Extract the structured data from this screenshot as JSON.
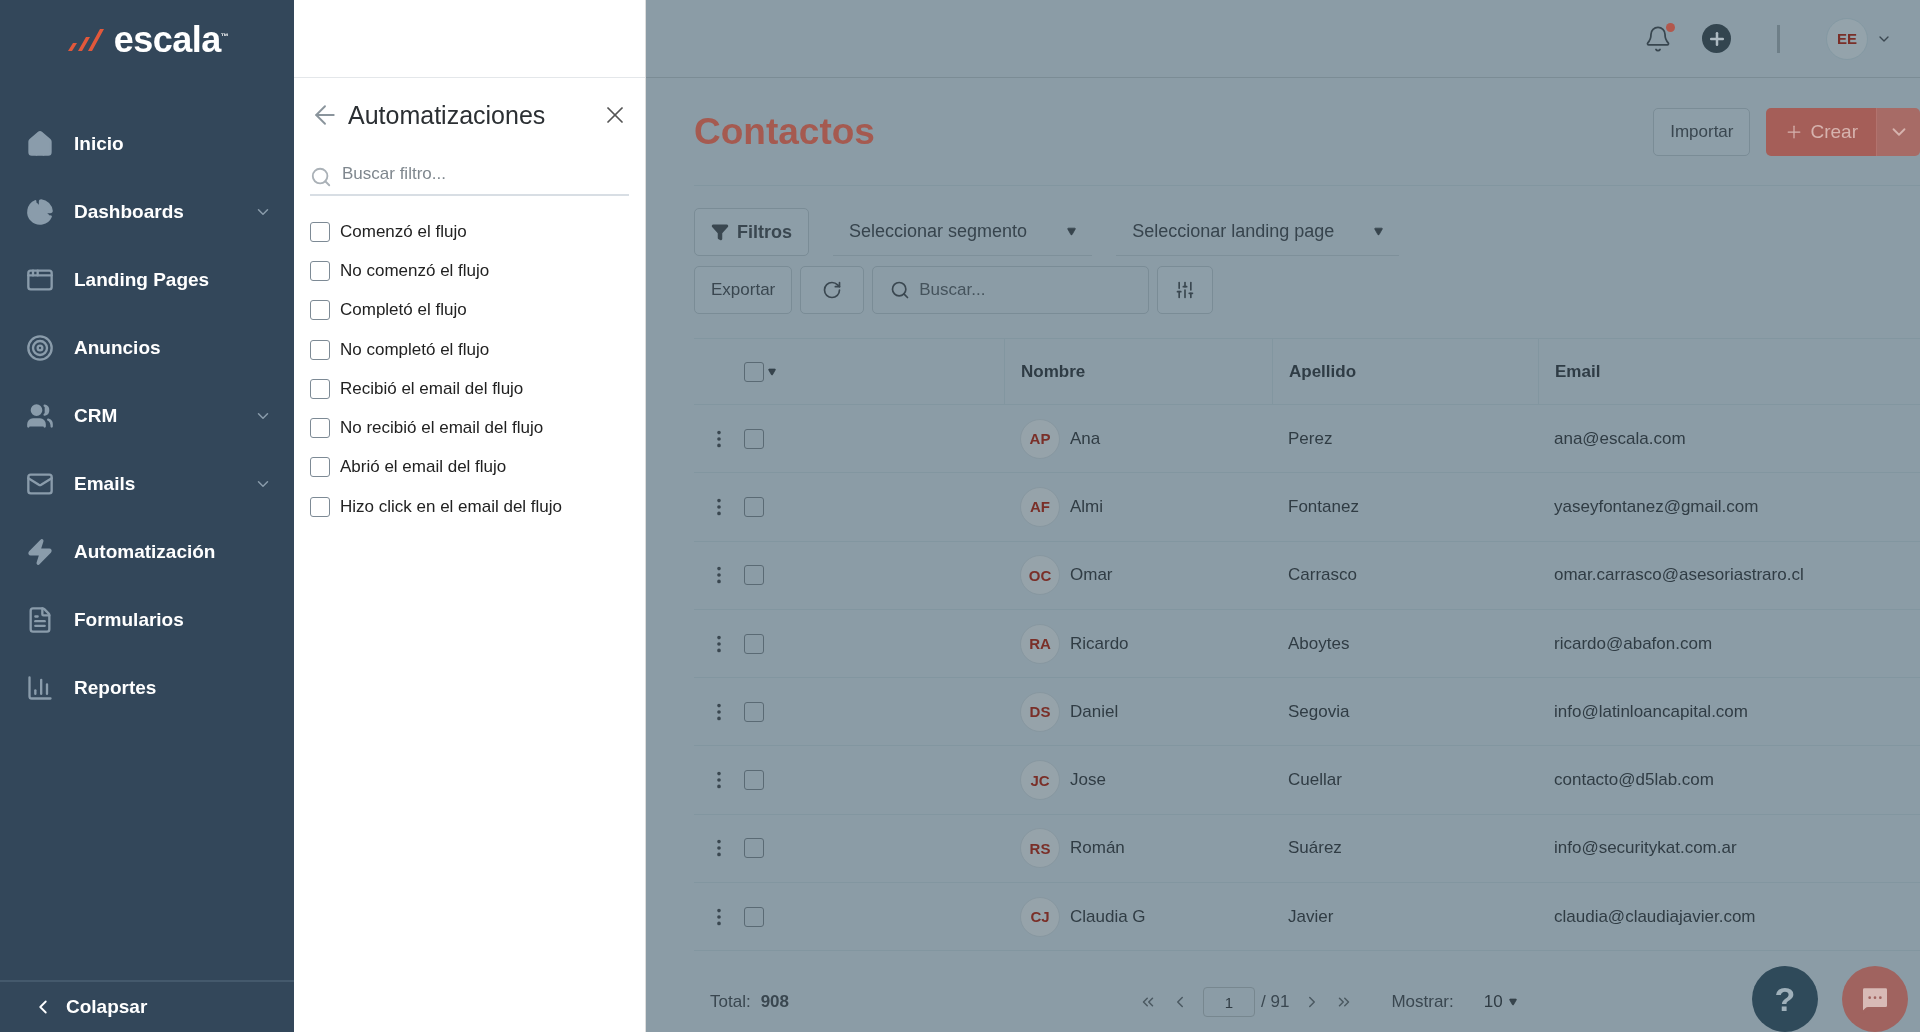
{
  "sidebar": {
    "logo": "escala",
    "trademark": "™",
    "items": [
      {
        "label": "Inicio",
        "has_submenu": false
      },
      {
        "label": "Dashboards",
        "has_submenu": true
      },
      {
        "label": "Landing Pages",
        "has_submenu": false
      },
      {
        "label": "Anuncios",
        "has_submenu": false
      },
      {
        "label": "CRM",
        "has_submenu": true
      },
      {
        "label": "Emails",
        "has_submenu": true
      },
      {
        "label": "Automatización",
        "has_submenu": false
      },
      {
        "label": "Formularios",
        "has_submenu": false
      },
      {
        "label": "Reportes",
        "has_submenu": false
      }
    ],
    "collapse": "Colapsar"
  },
  "drawer": {
    "title": "Automatizaciones",
    "search": {
      "placeholder": "Buscar filtro..."
    },
    "options": [
      {
        "label": "Comenzó el flujo",
        "checked": false
      },
      {
        "label": "No comenzó el flujo",
        "checked": false
      },
      {
        "label": "Completó el flujo",
        "checked": false
      },
      {
        "label": "No completó el flujo",
        "checked": false
      },
      {
        "label": "Recibió el email del flujo",
        "checked": false
      },
      {
        "label": "No recibió el email del flujo",
        "checked": false
      },
      {
        "label": "Abrió el email del flujo",
        "checked": false
      },
      {
        "label": "Hizo click en el email del flujo",
        "checked": false
      }
    ]
  },
  "topbar": {
    "unread_notifications": true,
    "avatar": "EE"
  },
  "page": {
    "title": "Contactos",
    "import": "Importar",
    "create": "Crear"
  },
  "filters": {
    "button": "Filtros",
    "segment": "Seleccionar segmento",
    "landing_page": "Seleccionar landing page"
  },
  "toolbar": {
    "export": "Exportar",
    "search": {
      "placeholder": "Buscar..."
    }
  },
  "table": {
    "all_selected": false,
    "columns": [
      "Nombre",
      "Apellido",
      "Email"
    ],
    "rows": [
      {
        "initials": "AP",
        "first": "Ana",
        "last": "Perez",
        "email": "ana@escala.com",
        "selected": false
      },
      {
        "initials": "AF",
        "first": "Almi",
        "last": "Fontanez",
        "email": "yaseyfontanez@gmail.com",
        "selected": false
      },
      {
        "initials": "OC",
        "first": "Omar",
        "last": "Carrasco",
        "email": "omar.carrasco@asesoriastraro.cl",
        "selected": false
      },
      {
        "initials": "RA",
        "first": "Ricardo",
        "last": "Aboytes",
        "email": "ricardo@abafon.com",
        "selected": false
      },
      {
        "initials": "DS",
        "first": "Daniel",
        "last": "Segovia",
        "email": "info@latinloancapital.com",
        "selected": false
      },
      {
        "initials": "JC",
        "first": "Jose",
        "last": "Cuellar",
        "email": "contacto@d5lab.com",
        "selected": false
      },
      {
        "initials": "RS",
        "first": "Román",
        "last": "Suárez",
        "email": "info@securitykat.com.ar",
        "selected": false
      },
      {
        "initials": "CJ",
        "first": "Claudia G",
        "last": "Javier",
        "email": "claudia@claudiajavier.com",
        "selected": false
      }
    ]
  },
  "footer": {
    "total_label": "Total:",
    "total": "908",
    "page": "1",
    "pages": "/ 91",
    "show_label": "Mostrar:",
    "page_size": "10"
  },
  "help": "?"
}
